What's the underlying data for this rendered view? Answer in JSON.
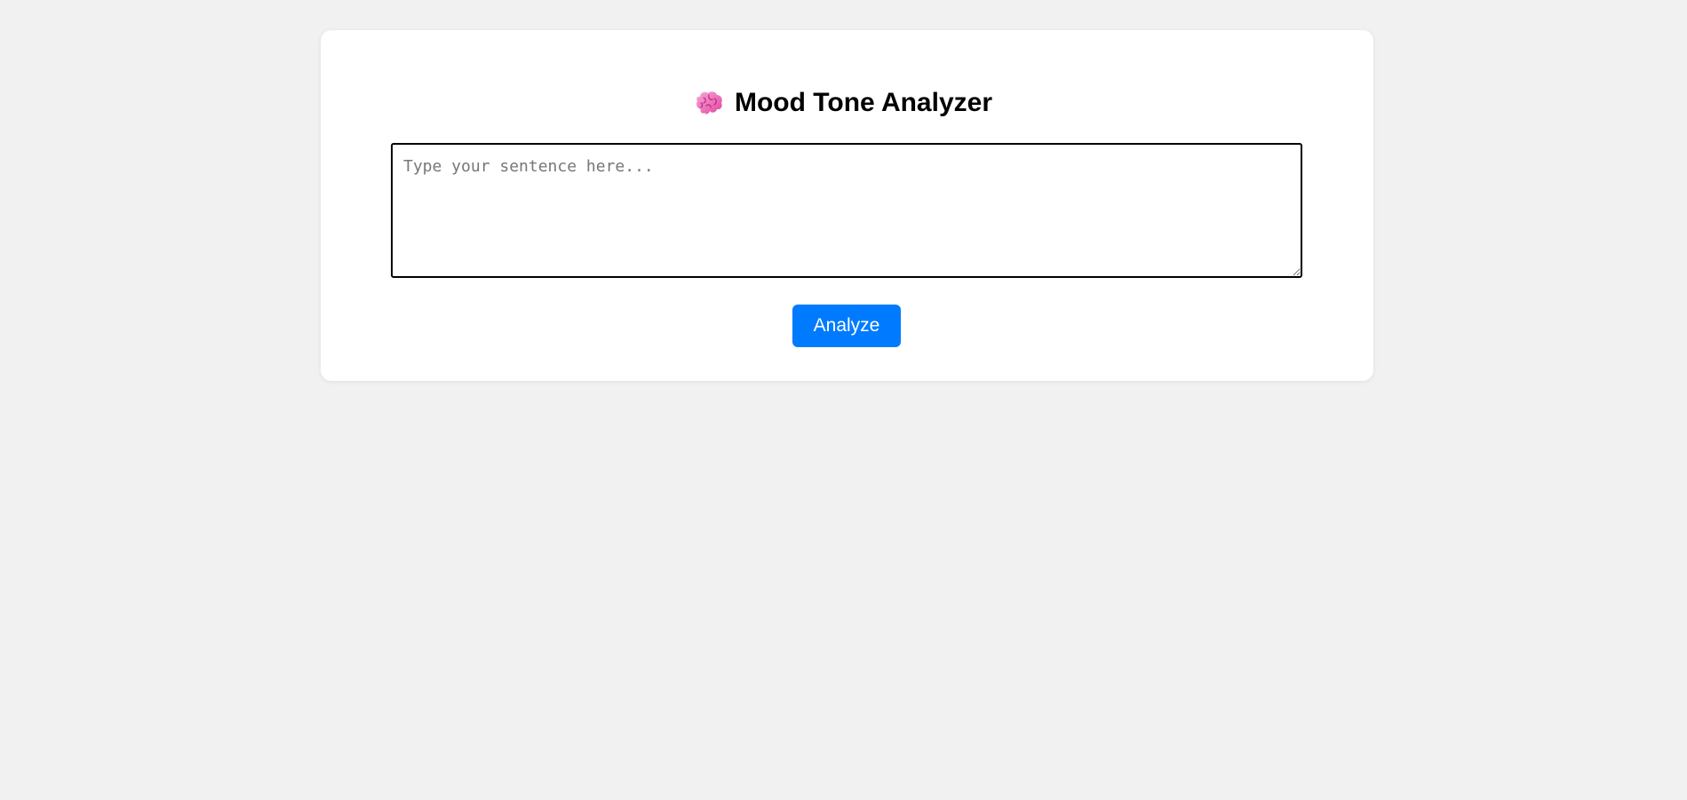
{
  "header": {
    "title": "Mood Tone Analyzer",
    "icon": "brain-icon"
  },
  "input": {
    "value": "",
    "placeholder": "Type your sentence here..."
  },
  "actions": {
    "analyze_label": "Analyze"
  },
  "colors": {
    "page_background": "#f1f1f1",
    "card_background": "#ffffff",
    "accent": "#007bff",
    "brain_icon": "#f06ab8"
  }
}
